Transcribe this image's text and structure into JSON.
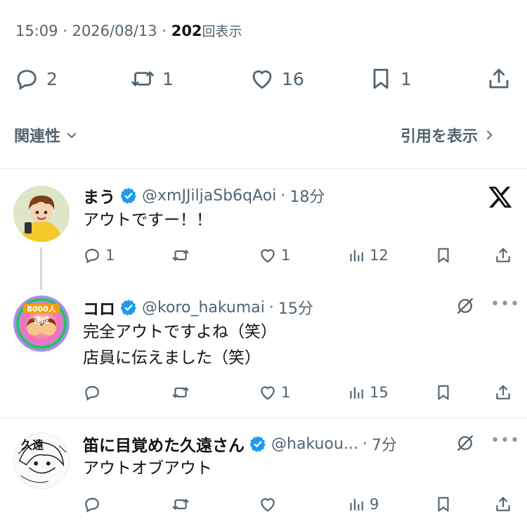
{
  "meta": {
    "time": "15:09",
    "sep1": "·",
    "date": "2026/08/13",
    "sep2": "·",
    "views": "202",
    "views_label": "回表示"
  },
  "actions": {
    "replies": "2",
    "reposts": "1",
    "likes": "16",
    "bookmarks": "1"
  },
  "filters": {
    "sort": "関連性",
    "quotes": "引用を表示"
  },
  "replies": [
    {
      "name": "まう",
      "handle": "@xmJJiljaSb6qAoi",
      "sep": "·",
      "time": "18分",
      "text": [
        "アウトですー！！"
      ],
      "stats": {
        "replies": "1",
        "reposts": "",
        "likes": "1",
        "views": "12"
      }
    },
    {
      "name": "コロ",
      "handle": "@koro_hakumai",
      "sep": "·",
      "time": "15分",
      "avatar_badge": "8000人達成",
      "text": [
        "完全アウトですよね（笑）",
        "店員に伝えました（笑）"
      ],
      "stats": {
        "replies": "",
        "reposts": "",
        "likes": "1",
        "views": "15"
      }
    },
    {
      "name": "笛に目覚めた久遠さん",
      "handle": "@hakuou...",
      "sep": "·",
      "time": "7分",
      "avatar_text": "久遠",
      "text": [
        "アウトオブアウト"
      ],
      "stats": {
        "replies": "",
        "reposts": "",
        "likes": "",
        "views": "9"
      }
    }
  ],
  "colors": {
    "accent": "#1d9bf0",
    "muted": "#536471",
    "text": "#0f1419",
    "border": "#e6ecf0"
  }
}
